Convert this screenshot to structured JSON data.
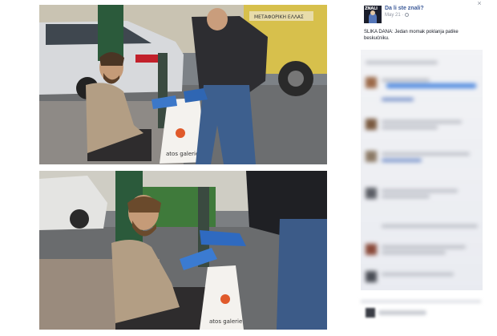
{
  "post": {
    "page_name": "Da li ste znali?",
    "page_avatar_abbr": "ZNALI",
    "date": "May 21 ·",
    "text": "SLIKA DANA: Jedan momak poklanja patike beskućniku."
  },
  "photos": {
    "bag_text_1": "atos galerie",
    "bag_text_2": "atos galerie",
    "truck_sign": "ΜΕΤΑΦΟΡΙΚΗ ΕΛΛΑΣ"
  },
  "ui": {
    "close_label": "×"
  },
  "colors": {
    "link": "#3b5998",
    "meta": "#9197a3",
    "text": "#141823"
  }
}
